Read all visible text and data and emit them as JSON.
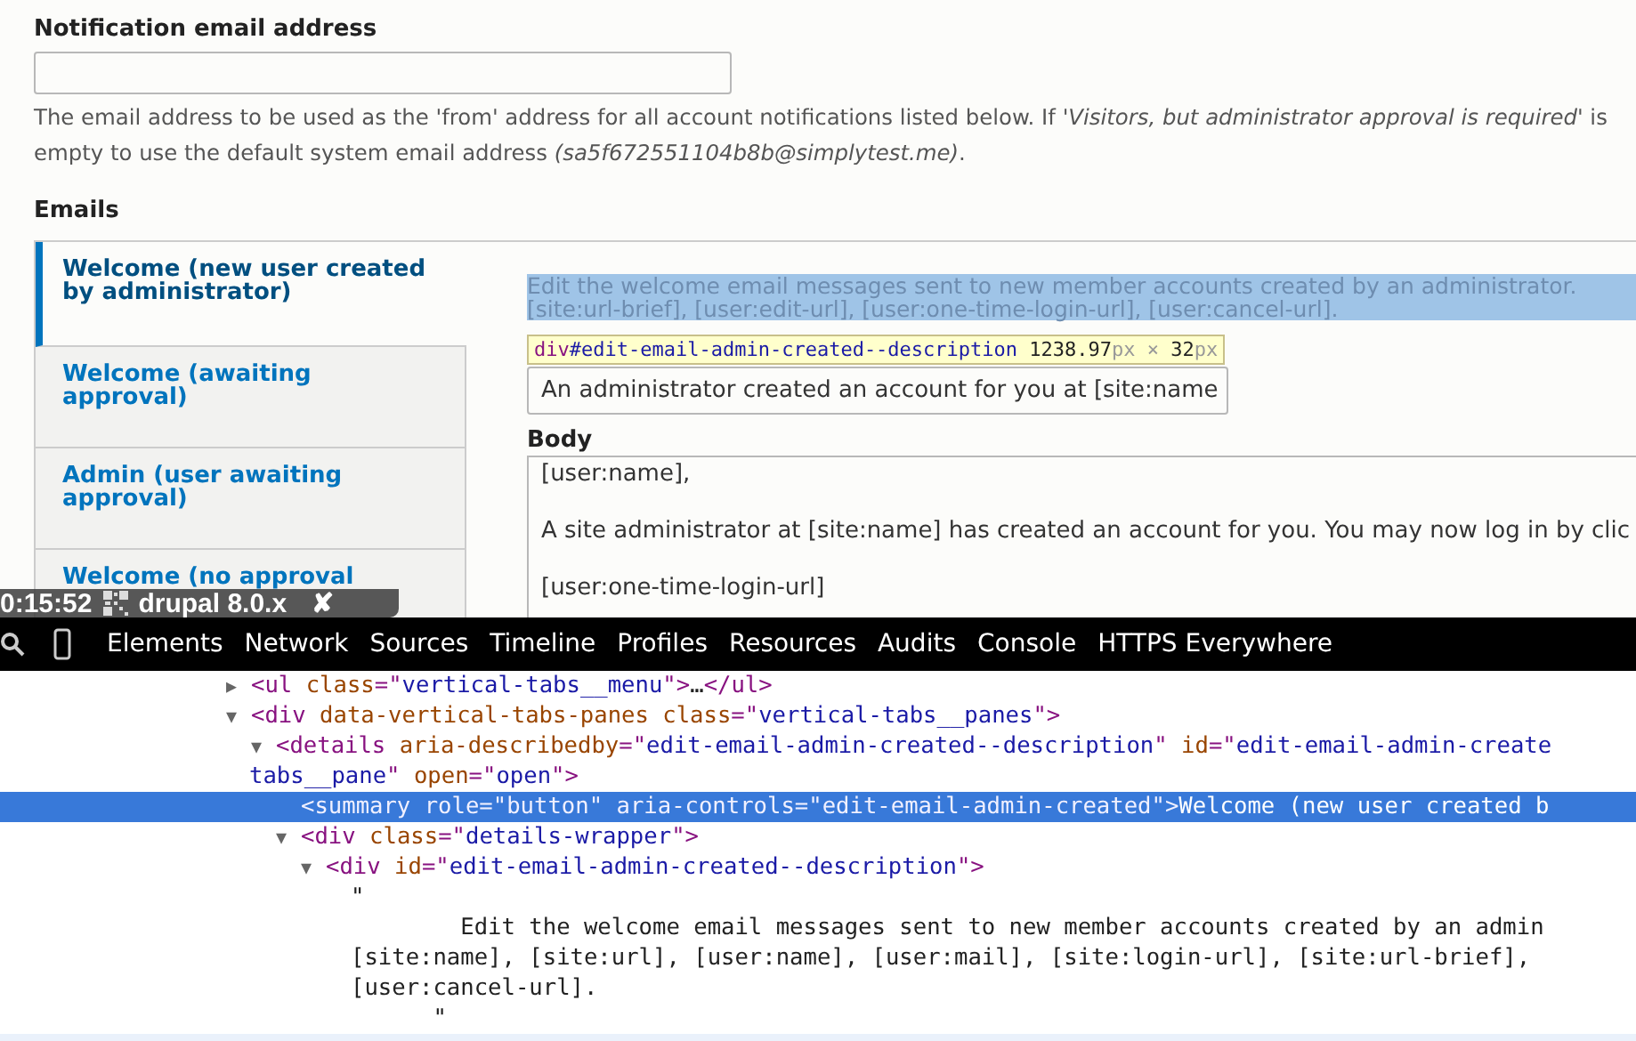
{
  "notification": {
    "label": "Notification email address",
    "description_lines": [
      "The email address to be used as the 'from' address for all account notifications listed below. If '*Visitors, but administrator approval is required*' is",
      "empty to use the default system email address *(sa5f672551104b8b@simplytest.me)*."
    ]
  },
  "emails": {
    "heading": "Emails",
    "tabs": [
      {
        "label": "Welcome (new user created by administrator)",
        "selected": true
      },
      {
        "label": "Welcome (awaiting approval)",
        "selected": false
      },
      {
        "label": "Admin (user awaiting approval)",
        "selected": false
      },
      {
        "label": "Welcome (no approval",
        "selected": false
      }
    ],
    "pane": {
      "description_lines": [
        "Edit the welcome email messages sent to new member accounts created by an administrator.",
        "[site:url-brief], [user:edit-url], [user:one-time-login-url], [user:cancel-url]."
      ],
      "subject_value": "An administrator created an account for you at [site:name",
      "body_label": "Body",
      "body_value": "[user:name],\n\nA site administrator at [site:name] has created an account for you. You may now log in by clic\n\n[user:one-time-login-url]"
    }
  },
  "inspect_tooltip": [
    {
      "kind": "tag",
      "text": "div"
    },
    {
      "kind": "id",
      "text": "#edit-email-admin-created--description"
    },
    {
      "kind": "num",
      "text": " 1238.97"
    },
    {
      "kind": "unit",
      "text": "px × "
    },
    {
      "kind": "num",
      "text": "32"
    },
    {
      "kind": "unit",
      "text": "px"
    }
  ],
  "overlay": {
    "time": "0:15:52",
    "title": "drupal 8.0.x",
    "close": "✘"
  },
  "devtools": {
    "tabs": [
      "Elements",
      "Network",
      "Sources",
      "Timeline",
      "Profiles",
      "Resources",
      "Audits",
      "Console",
      "HTTPS Everywhere"
    ],
    "dom_tree": [
      {
        "toggle": "▶",
        "selected": false,
        "lines": [
          [
            {
              "kind": "tag",
              "text": "<ul "
            },
            {
              "kind": "attr",
              "text": "class"
            },
            {
              "kind": "tag",
              "text": "=\""
            },
            {
              "kind": "value",
              "text": "vertical-tabs__menu"
            },
            {
              "kind": "tag",
              "text": "\">"
            },
            {
              "kind": "plain",
              "text": "…"
            },
            {
              "kind": "tag",
              "text": "</ul>"
            }
          ]
        ]
      },
      {
        "toggle": "▼",
        "selected": false,
        "lines": [
          [
            {
              "kind": "tag",
              "text": "<div "
            },
            {
              "kind": "attr",
              "text": "data-vertical-tabs-panes class"
            },
            {
              "kind": "tag",
              "text": "=\""
            },
            {
              "kind": "value",
              "text": "vertical-tabs__panes"
            },
            {
              "kind": "tag",
              "text": "\">"
            }
          ]
        ],
        "children": [
          {
            "toggle": "▼",
            "selected": false,
            "lines": [
              [
                {
                  "kind": "tag",
                  "text": "<details "
                },
                {
                  "kind": "attr",
                  "text": "aria-describedby"
                },
                {
                  "kind": "tag",
                  "text": "=\""
                },
                {
                  "kind": "value",
                  "text": "edit-email-admin-created--description"
                },
                {
                  "kind": "tag",
                  "text": "\" "
                },
                {
                  "kind": "attr",
                  "text": "id"
                },
                {
                  "kind": "tag",
                  "text": "=\""
                },
                {
                  "kind": "value",
                  "text": "edit-email-admin-create"
                }
              ],
              [
                {
                  "kind": "value",
                  "text": "tabs__pane"
                },
                {
                  "kind": "tag",
                  "text": "\" "
                },
                {
                  "kind": "attr",
                  "text": "open"
                },
                {
                  "kind": "tag",
                  "text": "=\""
                },
                {
                  "kind": "value",
                  "text": "open"
                },
                {
                  "kind": "tag",
                  "text": "\">"
                }
              ]
            ],
            "children": [
              {
                "selected": true,
                "lines": [
                  [
                    {
                      "kind": "tag",
                      "text": "<summary "
                    },
                    {
                      "kind": "attr",
                      "text": "role"
                    },
                    {
                      "kind": "tag",
                      "text": "=\""
                    },
                    {
                      "kind": "value",
                      "text": "button"
                    },
                    {
                      "kind": "tag",
                      "text": "\" "
                    },
                    {
                      "kind": "attr",
                      "text": "aria-controls"
                    },
                    {
                      "kind": "tag",
                      "text": "=\""
                    },
                    {
                      "kind": "value",
                      "text": "edit-email-admin-created"
                    },
                    {
                      "kind": "tag",
                      "text": "\">"
                    },
                    {
                      "kind": "plain",
                      "text": "Welcome (new user created b"
                    }
                  ]
                ]
              },
              {
                "toggle": "▼",
                "selected": false,
                "lines": [
                  [
                    {
                      "kind": "tag",
                      "text": "<div "
                    },
                    {
                      "kind": "attr",
                      "text": "class"
                    },
                    {
                      "kind": "tag",
                      "text": "=\""
                    },
                    {
                      "kind": "value",
                      "text": "details-wrapper"
                    },
                    {
                      "kind": "tag",
                      "text": "\">"
                    }
                  ]
                ],
                "children": [
                  {
                    "toggle": "▼",
                    "selected": false,
                    "lines": [
                      [
                        {
                          "kind": "tag",
                          "text": "<div "
                        },
                        {
                          "kind": "attr",
                          "text": "id"
                        },
                        {
                          "kind": "tag",
                          "text": "=\""
                        },
                        {
                          "kind": "value",
                          "text": "edit-email-admin-created--description"
                        },
                        {
                          "kind": "tag",
                          "text": "\">"
                        }
                      ]
                    ],
                    "children": [
                      {
                        "selected": false,
                        "lines": [
                          [
                            {
                              "kind": "plain",
                              "text": "\""
                            }
                          ],
                          [
                            {
                              "kind": "plain",
                              "text": "        Edit the welcome email messages sent to new member accounts created by an admin"
                            }
                          ],
                          [
                            {
                              "kind": "plain",
                              "text": "[site:name], [site:url], [user:name], [user:mail], [site:login-url], [site:url-brief],"
                            }
                          ],
                          [
                            {
                              "kind": "plain",
                              "text": "[user:cancel-url]."
                            }
                          ],
                          [
                            {
                              "kind": "plain",
                              "text": "      \""
                            }
                          ]
                        ]
                      }
                    ]
                  }
                ]
              }
            ]
          }
        ]
      }
    ]
  }
}
